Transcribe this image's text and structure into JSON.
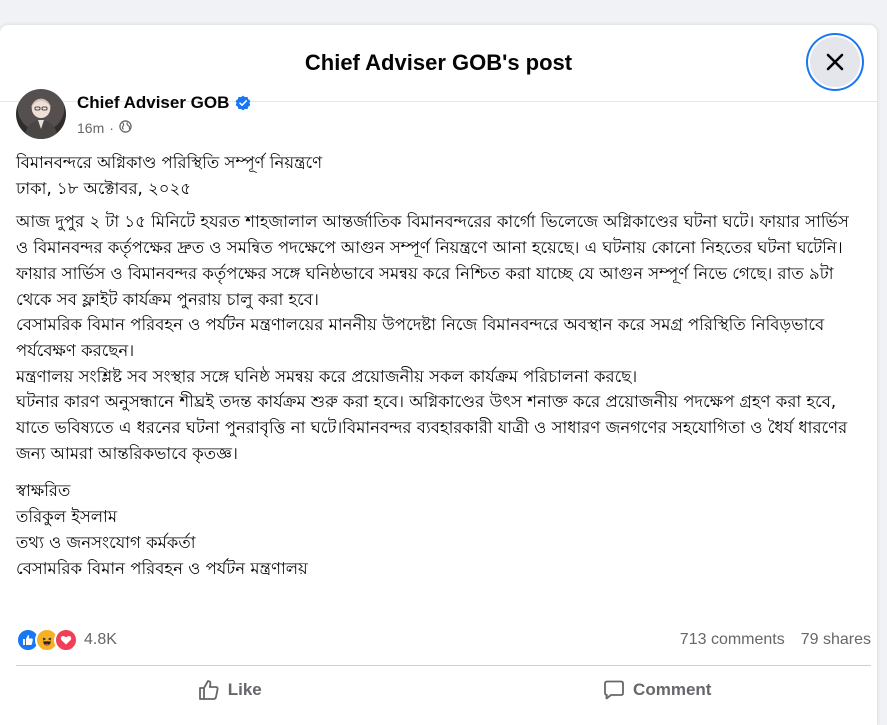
{
  "dialog": {
    "title": "Chief Adviser GOB's post"
  },
  "post": {
    "author": "Chief Adviser GOB",
    "time": "16m",
    "separator": "·",
    "audience_icon": "globe-icon",
    "verified_icon": "verified-badge-icon",
    "paragraphs": [
      "বিমানবন্দরে অগ্নিকাণ্ড পরিস্থিতি সম্পূর্ণ নিয়ন্ত্রণে\nঢাকা, ১৮ অক্টোবর, ২০২৫",
      "আজ দুপুর ২ টা ১৫ মিনিটে হযরত শাহজালাল আন্তর্জাতিক বিমানবন্দরের কার্গো ভিলেজে অগ্নিকাণ্ডের ঘটনা ঘটে। ফায়ার সার্ভিস ও বিমানবন্দর কর্তৃপক্ষের দ্রুত ও সমন্বিত পদক্ষেপে আগুন সম্পূর্ণ নিয়ন্ত্রণে আনা হয়েছে। এ ঘটনায় কোনো নিহতের ঘটনা ঘটেনি।\nফায়ার সার্ভিস ও বিমানবন্দর কর্তৃপক্ষের সঙ্গে ঘনিষ্ঠভাবে সমন্বয় করে নিশ্চিত করা যাচ্ছে যে আগুন সম্পূর্ণ নিভে গেছে। রাত ৯টা থেকে সব ফ্লাইট কার্যক্রম পুনরায় চালু করা হবে।\nবেসামরিক বিমান পরিবহন ও পর্যটন মন্ত্রণালয়ের মাননীয় উপদেষ্টা নিজে বিমানবন্দরে অবস্থান করে সমগ্র পরিস্থিতি নিবিড়ভাবে পর্যবেক্ষণ করছেন।\nমন্ত্রণালয় সংশ্লিষ্ট সব সংস্থার সঙ্গে ঘনিষ্ঠ সমন্বয় করে প্রয়োজনীয় সকল কার্যক্রম পরিচালনা করছে।\nঘটনার কারণ অনুসন্ধানে শীঘ্রই তদন্ত কার্যক্রম শুরু করা হবে। অগ্নিকাণ্ডের উৎস শনাক্ত করে প্রয়োজনীয় পদক্ষেপ গ্রহণ করা হবে, যাতে ভবিষ্যতে এ ধরনের ঘটনা পুনরাবৃত্তি না ঘটে।বিমানবন্দর ব্যবহারকারী যাত্রী ও সাধারণ জনগণের সহযোগিতা ও ধৈর্য ধারণের জন্য আমরা আন্তরিকভাবে কৃতজ্ঞ।",
      "স্বাক্ষরিত\nতরিকুল ইসলাম\nতথ্য ও জনসংযোগ কর্মকর্তা\nবেসামরিক বিমান পরিবহন ও পর্যটন মন্ত্রণালয়"
    ]
  },
  "engagement": {
    "reaction_icons": [
      "like-icon",
      "haha-icon",
      "love-icon"
    ],
    "reaction_count": "4.8K",
    "comments": "713 comments",
    "shares": "79 shares"
  },
  "actions": {
    "like_label": "Like",
    "comment_label": "Comment"
  },
  "colors": {
    "accent": "#1877f2",
    "love": "#f33e58",
    "haha": "#f7b125",
    "secondary_text": "#65676b"
  }
}
